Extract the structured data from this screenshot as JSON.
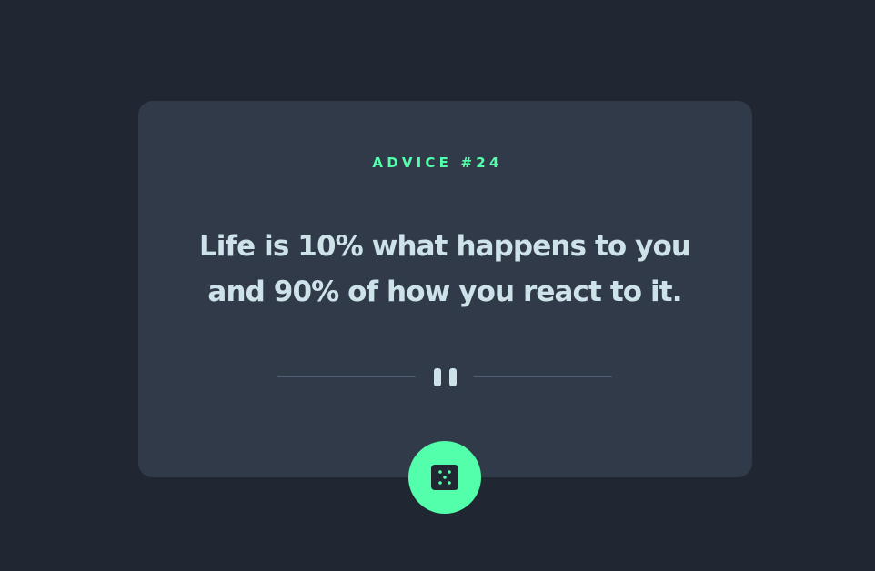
{
  "advice": {
    "label": "ADVICE #24",
    "quote": "Life is 10% what happens to you and 90% of how you react to it."
  },
  "divider": {
    "icon": "pause-icon"
  },
  "button": {
    "icon": "dice-icon",
    "color": "#53ffaa"
  },
  "colors": {
    "background": "#202632",
    "card": "#313a49",
    "accent": "#53ffaa",
    "text": "#cee3e9",
    "divider": "#4f5d74"
  }
}
